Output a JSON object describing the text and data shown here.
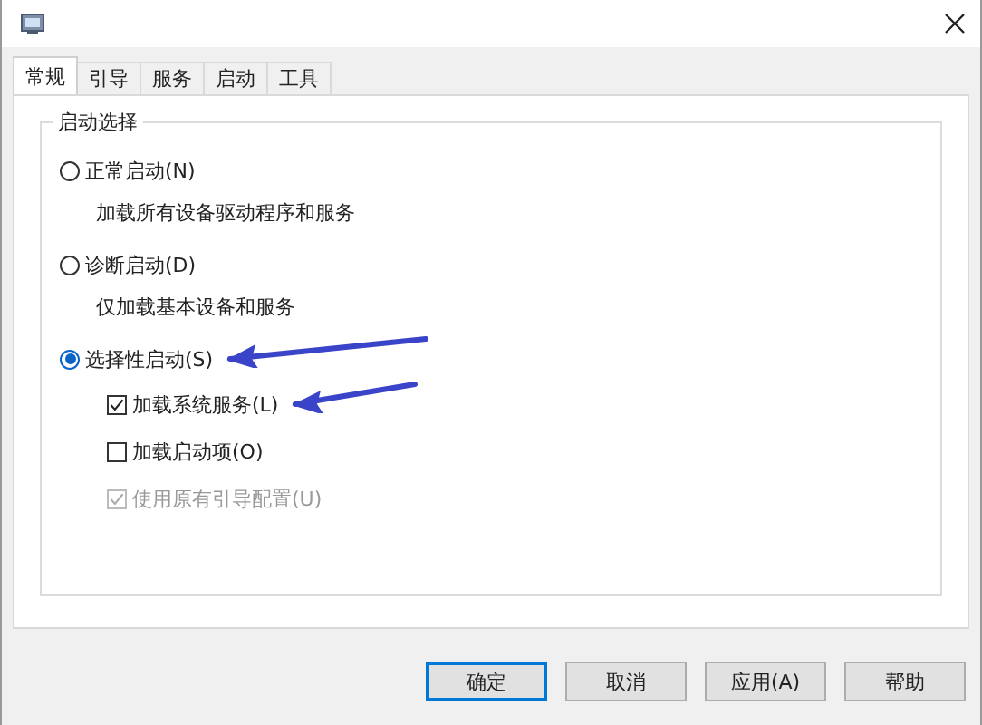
{
  "tabs": [
    {
      "label": "常规",
      "selected": true
    },
    {
      "label": "引导",
      "selected": false
    },
    {
      "label": "服务",
      "selected": false
    },
    {
      "label": "启动",
      "selected": false
    },
    {
      "label": "工具",
      "selected": false
    }
  ],
  "group": {
    "title": "启动选择",
    "options": [
      {
        "kind": "radio",
        "label": "正常启动(N)",
        "selected": false,
        "pointer_arrow": false
      },
      {
        "kind": "description",
        "text": "加载所有设备驱动程序和服务"
      },
      {
        "kind": "radio",
        "label": "诊断启动(D)",
        "selected": false,
        "pointer_arrow": false
      },
      {
        "kind": "description",
        "text": "仅加载基本设备和服务"
      },
      {
        "kind": "radio",
        "label": "选择性启动(S)",
        "selected": true,
        "pointer_arrow": true
      },
      {
        "kind": "checkbox",
        "label": "加载系统服务(L)",
        "checked": true,
        "disabled": false,
        "pointer_arrow": true
      },
      {
        "kind": "checkbox",
        "label": "加载启动项(O)",
        "checked": false,
        "disabled": false,
        "pointer_arrow": false
      },
      {
        "kind": "checkbox",
        "label": "使用原有引导配置(U)",
        "checked": true,
        "disabled": true,
        "pointer_arrow": false
      }
    ]
  },
  "buttons": [
    {
      "label": "确定",
      "default": true
    },
    {
      "label": "取消",
      "default": false
    },
    {
      "label": "应用(A)",
      "default": false
    },
    {
      "label": "帮助",
      "default": false
    }
  ]
}
